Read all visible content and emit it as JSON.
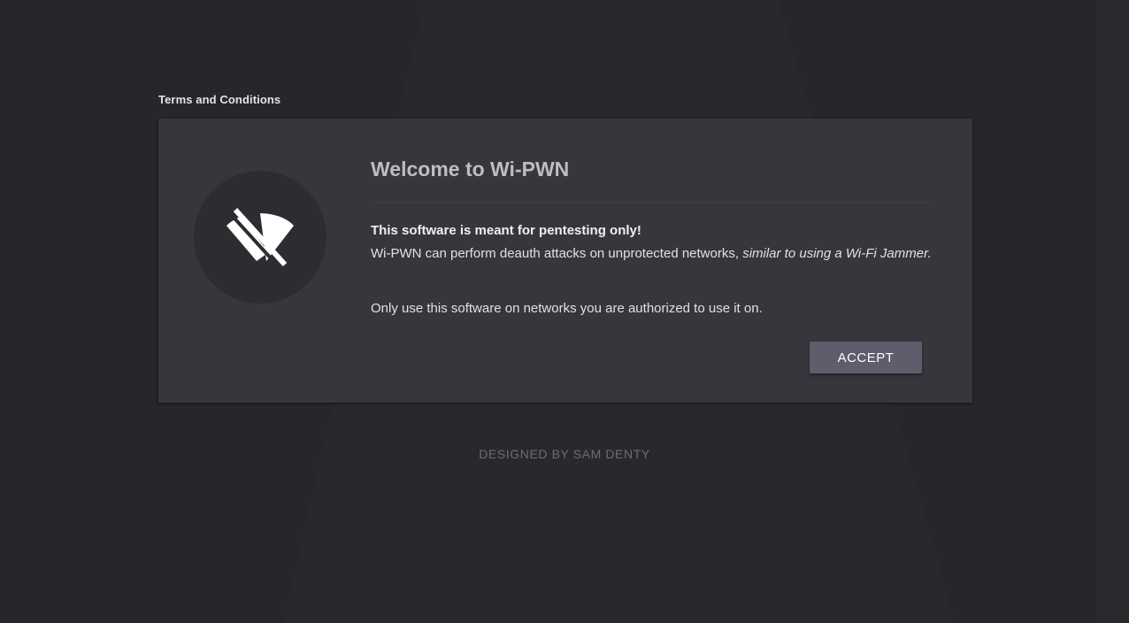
{
  "page": {
    "section_title": "Terms and Conditions",
    "footer": "DESIGNED BY SAM DENTY"
  },
  "card": {
    "icon": "wifi-off-icon",
    "title": "Welcome to Wi-PWN",
    "warning": "This software is meant for pentesting only!",
    "description_plain": "Wi-PWN can perform deauth attacks on unprotected networks, ",
    "description_italic": "similar to using a Wi-Fi Jammer.",
    "authorized_note": "Only use this software on networks you are authorized to use it on.",
    "accept_label": "ACCEPT"
  },
  "colors": {
    "background": "#26262b",
    "card": "#36363d",
    "button": "#5d5d6b",
    "title": "#bdbdc2"
  }
}
